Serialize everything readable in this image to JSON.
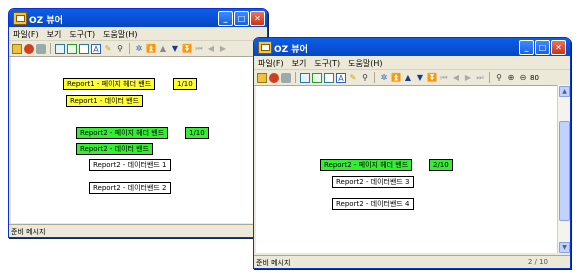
{
  "window1": {
    "title": "OZ 뷰어",
    "menu": [
      "파일(F)",
      "보기",
      "도구(T)",
      "도움말(H)"
    ],
    "status": "준비 메시지",
    "bands": {
      "b1": "Report1 - 페이지 헤더 밴드",
      "b1_page": "1/10",
      "b2": "Report1 - 데이터 밴드",
      "b3": "Report2 - 페이지 헤더 밴드",
      "b3_page": "1/10",
      "b4": "Report2 - 데이터 밴드",
      "b5": "Report2 - 데이터밴드 1",
      "b6": "Report2 - 데이터밴드 2"
    }
  },
  "window2": {
    "title": "OZ 뷰어",
    "menu": [
      "파일(F)",
      "보기",
      "도구(T)",
      "도움말(H)"
    ],
    "status": "준비 메시지",
    "page_indicator": "2 / 10",
    "zoom": "80",
    "bands": {
      "b1": "Report2 - 페이지 헤더 밴드",
      "b1_page": "2/10",
      "b2": "Report2 - 데이터밴드 3",
      "b3": "Report2 - 데이터밴드 4"
    }
  },
  "colors": {
    "titlebar": "#0a52d8",
    "yellow_band": "#ffff33",
    "green_band": "#33ee33",
    "window_bg": "#ece9d8"
  }
}
